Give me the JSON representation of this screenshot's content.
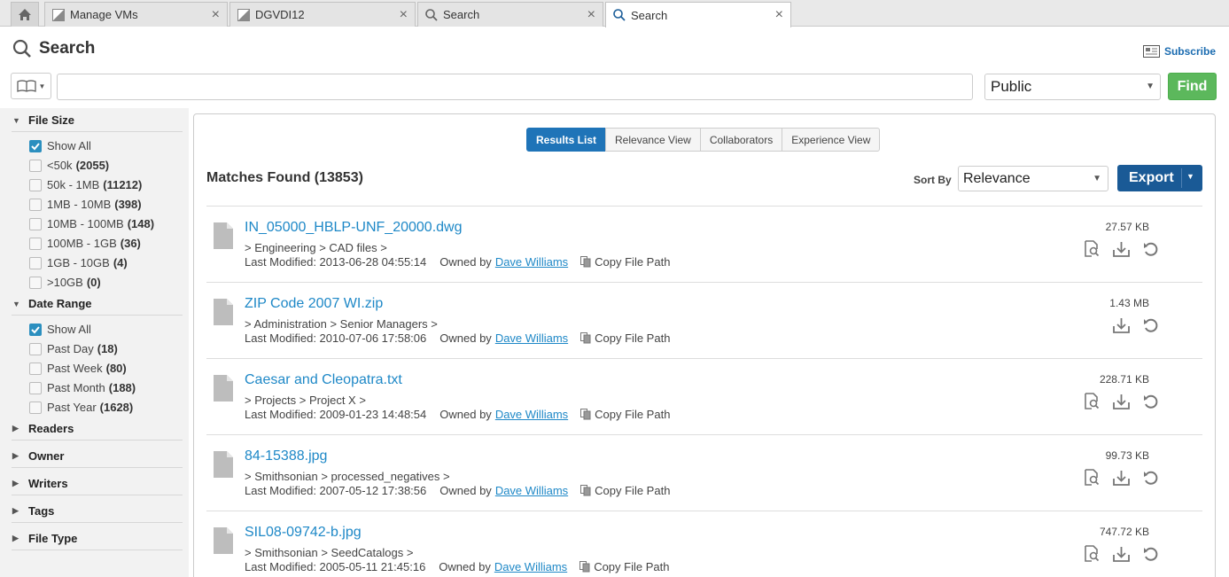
{
  "tabs": [
    {
      "label": "Manage VMs",
      "icon": "vm-icon"
    },
    {
      "label": "DGVDI12",
      "icon": "vm-icon"
    },
    {
      "label": "Search",
      "icon": "search-icon"
    },
    {
      "label": "Search",
      "icon": "search-icon",
      "active": true
    }
  ],
  "tab_close": "×",
  "header": {
    "title": "Search",
    "subscribe_label": "Subscribe"
  },
  "search": {
    "query": "",
    "scope_value": "Public",
    "find_label": "Find"
  },
  "sidebar": {
    "file_size": {
      "title": "File Size",
      "options": [
        {
          "label": "Show All",
          "count": "",
          "checked": true
        },
        {
          "label": "<50k",
          "count": "(2055)"
        },
        {
          "label": "50k - 1MB",
          "count": "(11212)"
        },
        {
          "label": "1MB - 10MB",
          "count": "(398)"
        },
        {
          "label": "10MB - 100MB",
          "count": "(148)"
        },
        {
          "label": "100MB - 1GB",
          "count": "(36)"
        },
        {
          "label": "1GB - 10GB",
          "count": "(4)"
        },
        {
          "label": ">10GB",
          "count": "(0)"
        }
      ]
    },
    "date_range": {
      "title": "Date Range",
      "options": [
        {
          "label": "Show All",
          "count": "",
          "checked": true
        },
        {
          "label": "Past Day",
          "count": "(18)"
        },
        {
          "label": "Past Week",
          "count": "(80)"
        },
        {
          "label": "Past Month",
          "count": "(188)"
        },
        {
          "label": "Past Year",
          "count": "(1628)"
        }
      ]
    },
    "collapsed": [
      "Readers",
      "Owner",
      "Writers",
      "Tags",
      "File Type"
    ]
  },
  "views": [
    "Results List",
    "Relevance View",
    "Collaborators",
    "Experience View"
  ],
  "results_header": {
    "matches": "Matches Found (13853)",
    "sort_by_label": "Sort By",
    "sort_value": "Relevance",
    "export_label": "Export"
  },
  "results": [
    {
      "name": "IN_05000_HBLP-UNF_20000.dwg",
      "path": "> Engineering > CAD files >",
      "modified": "Last Modified: 2013-06-28 04:55:14",
      "owner_label": "Owned by",
      "owner": "Dave Williams",
      "copy_label": "Copy File Path",
      "size": "27.57 KB",
      "preview": true
    },
    {
      "name": "ZIP Code 2007 WI.zip",
      "path": "> Administration > Senior Managers >",
      "modified": "Last Modified: 2010-07-06 17:58:06",
      "owner_label": "Owned by",
      "owner": "Dave Williams",
      "copy_label": "Copy File Path",
      "size": "1.43 MB",
      "preview": false
    },
    {
      "name": "Caesar and Cleopatra.txt",
      "path": "> Projects > Project X >",
      "modified": "Last Modified: 2009-01-23 14:48:54",
      "owner_label": "Owned by",
      "owner": "Dave Williams",
      "copy_label": "Copy File Path",
      "size": "228.71 KB",
      "preview": true
    },
    {
      "name": "84-15388.jpg",
      "path": "> Smithsonian > processed_negatives >",
      "modified": "Last Modified: 2007-05-12 17:38:56",
      "owner_label": "Owned by",
      "owner": "Dave Williams",
      "copy_label": "Copy File Path",
      "size": "99.73 KB",
      "preview": true
    },
    {
      "name": "SIL08-09742-b.jpg",
      "path": "> Smithsonian > SeedCatalogs >",
      "modified": "Last Modified: 2005-05-11 21:45:16",
      "owner_label": "Owned by",
      "owner": "Dave Williams",
      "copy_label": "Copy File Path",
      "size": "747.72 KB",
      "preview": true
    }
  ],
  "colors": {
    "accent": "#1f74b8",
    "link": "#1e88c7",
    "find": "#5cb85c",
    "export": "#1a5a96"
  }
}
